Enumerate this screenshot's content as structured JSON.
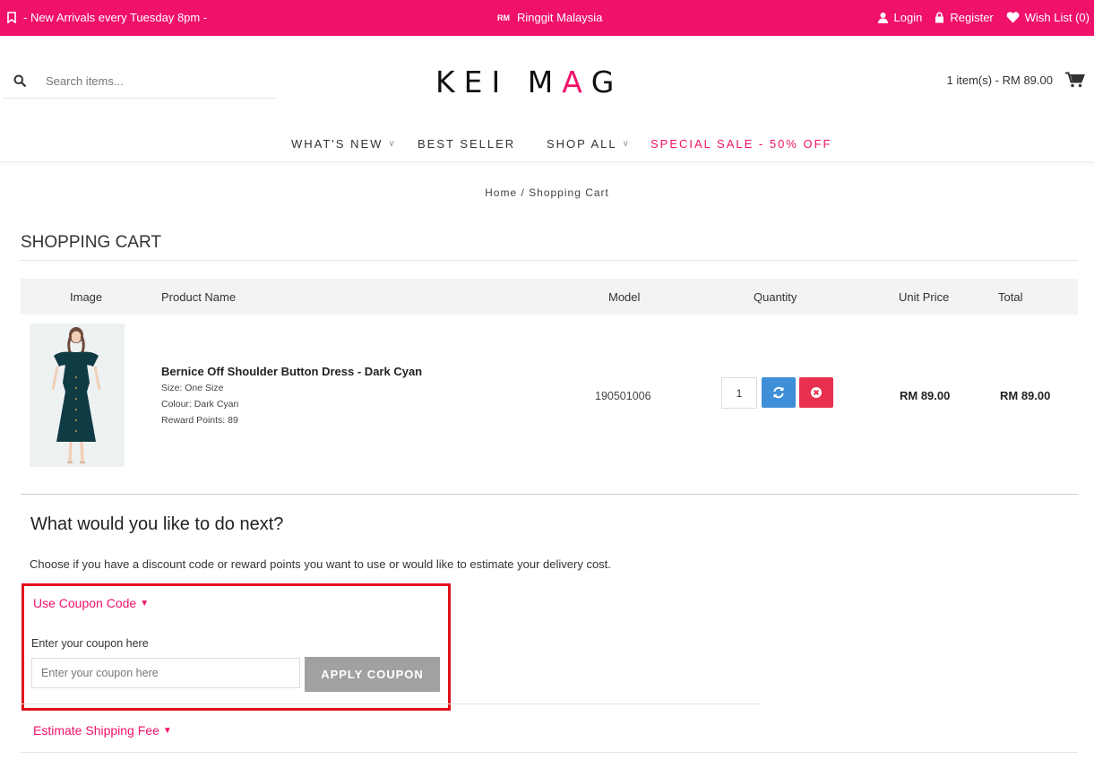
{
  "topbar": {
    "promo_text": "- New Arrivals every Tuesday 8pm -",
    "currency_code": "RM",
    "currency_label": "Ringgit Malaysia",
    "login": "Login",
    "register": "Register",
    "wishlist": "Wish List (0)",
    "bg_color": "#f0116b"
  },
  "header": {
    "search_placeholder": "Search items...",
    "logo_part1": "KEI M",
    "logo_accent": "A",
    "logo_part2": "G",
    "cart_summary": "1 item(s) - RM 89.00"
  },
  "nav": {
    "items": [
      {
        "label": "WHAT'S NEW",
        "has_dropdown": true
      },
      {
        "label": "BEST SELLER",
        "has_dropdown": false
      },
      {
        "label": "SHOP ALL",
        "has_dropdown": true
      },
      {
        "label": "SPECIAL SALE - 50% OFF",
        "has_dropdown": false
      }
    ]
  },
  "breadcrumb": {
    "home": "Home",
    "separator": "/",
    "current": "Shopping Cart"
  },
  "page_title": "SHOPPING CART",
  "cart": {
    "headers": {
      "image": "Image",
      "product_name": "Product Name",
      "model": "Model",
      "quantity": "Quantity",
      "unit_price": "Unit Price",
      "total": "Total"
    },
    "items": [
      {
        "name": "Bernice Off Shoulder Button Dress - Dark Cyan",
        "options": [
          "Size: One Size",
          "Colour: Dark Cyan",
          "Reward Points: 89"
        ],
        "model": "190501006",
        "quantity": "1",
        "unit_price": "RM 89.00",
        "total": "RM 89.00"
      }
    ]
  },
  "next": {
    "heading": "What would you like to do next?",
    "description": "Choose if you have a discount code or reward points you want to use or would like to estimate your delivery cost.",
    "coupon": {
      "title": "Use Coupon Code",
      "label": "Enter your coupon here",
      "placeholder": "Enter your coupon here",
      "button": "APPLY COUPON"
    },
    "shipping": {
      "title": "Estimate Shipping Fee"
    }
  }
}
